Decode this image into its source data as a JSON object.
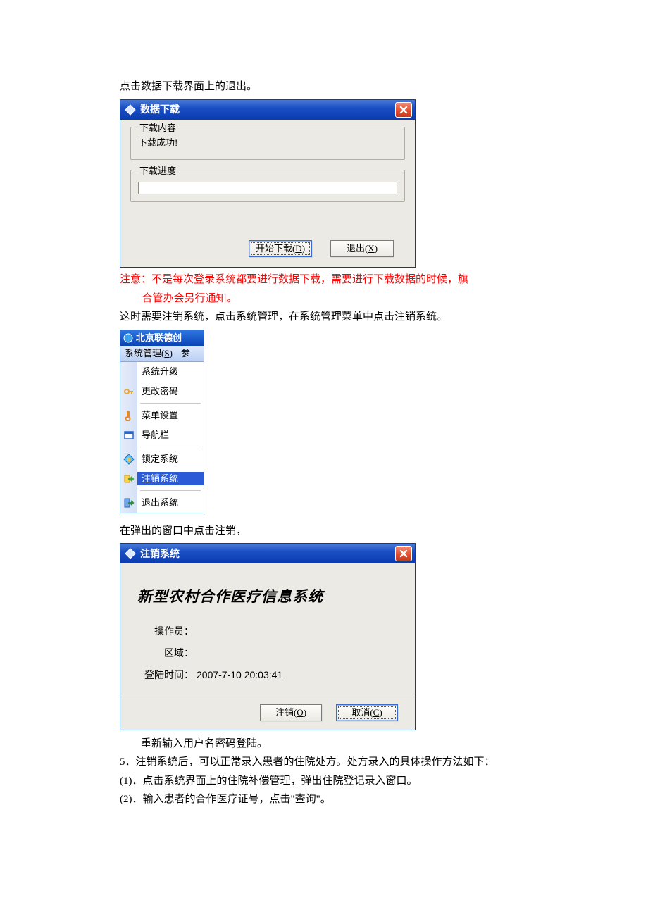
{
  "doc": {
    "p1": "点击数据下载界面上的退出。",
    "p2a": "注意：不是每次登录系统都要进行数据下载，需要进行下载数据的时候，旗",
    "p2b": "合管办会另行通知。",
    "p3": "这时需要注销系统，点击系统管理，在系统管理菜单中点击注销系统。",
    "p4": "在弹出的窗口中点击注销，",
    "p5": "重新输入用户名密码登陆。",
    "p6": "5．注销系统后，可以正常录入患者的住院处方。处方录入的具体操作方法如下：",
    "p7": "(1)．点击系统界面上的住院补偿管理，弹出住院登记录入窗口。",
    "p8": "(2)．输入患者的合作医疗证号，点击\"查询\"。"
  },
  "win1": {
    "title": "数据下载",
    "gb1_legend": "下载内容",
    "gb1_content": "下载成功!",
    "gb2_legend": "下载进度",
    "btn_start_pre": "开始下载(",
    "btn_start_u": "D",
    "btn_start_post": ")",
    "btn_exit_pre": "退出(",
    "btn_exit_u": "X",
    "btn_exit_post": ")"
  },
  "win2": {
    "title": "北京联德创",
    "menubar1_pre": "系统管理(",
    "menubar1_u": "S",
    "menubar1_post": ")",
    "menubar2": "参",
    "items": {
      "upgrade": "系统升级",
      "changepw": "更改密码",
      "menuset": "菜单设置",
      "navbar": "导航栏",
      "lock": "锁定系统",
      "logout": "注销系统",
      "exit": "退出系统"
    }
  },
  "win3": {
    "title": "注销系统",
    "heading": "新型农村合作医疗信息系统",
    "operator_label": "操作员：",
    "operator_value": "",
    "region_label": "区域：",
    "region_value": "",
    "login_time_label": "登陆时间：",
    "login_time_value": "2007-7-10 20:03:41",
    "btn_logout_pre": "注销(",
    "btn_logout_u": "O",
    "btn_logout_post": ")",
    "btn_cancel_pre": "取消(",
    "btn_cancel_u": "C",
    "btn_cancel_post": ")"
  }
}
